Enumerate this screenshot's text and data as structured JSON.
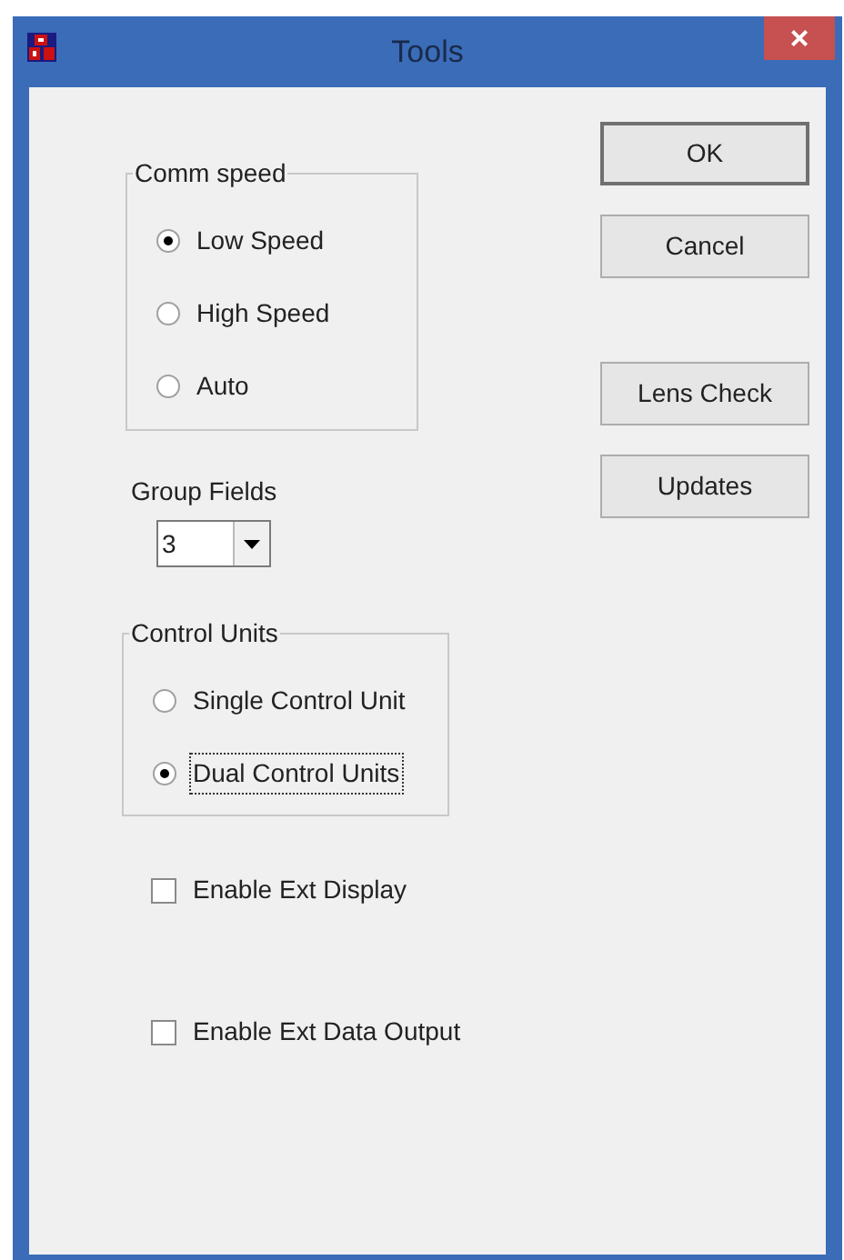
{
  "window": {
    "title": "Tools",
    "close": "×"
  },
  "comm_speed": {
    "title": "Comm speed",
    "options": [
      {
        "label": "Low Speed",
        "selected": true
      },
      {
        "label": "High Speed",
        "selected": false
      },
      {
        "label": "Auto",
        "selected": false
      }
    ]
  },
  "group_fields": {
    "label": "Group Fields",
    "value": "3"
  },
  "control_units": {
    "title": "Control Units",
    "options": [
      {
        "label": "Single Control Unit",
        "selected": false,
        "focused": false
      },
      {
        "label": "Dual Control Units",
        "selected": true,
        "focused": true
      }
    ]
  },
  "checkboxes": [
    {
      "label": "Enable Ext Display",
      "checked": false
    },
    {
      "label": "Enable Ext Data Output",
      "checked": false
    }
  ],
  "buttons": [
    {
      "label": "OK",
      "default": true
    },
    {
      "label": "Cancel",
      "default": false
    },
    {
      "label": "Lens Check",
      "default": false
    },
    {
      "label": "Updates",
      "default": false
    }
  ]
}
